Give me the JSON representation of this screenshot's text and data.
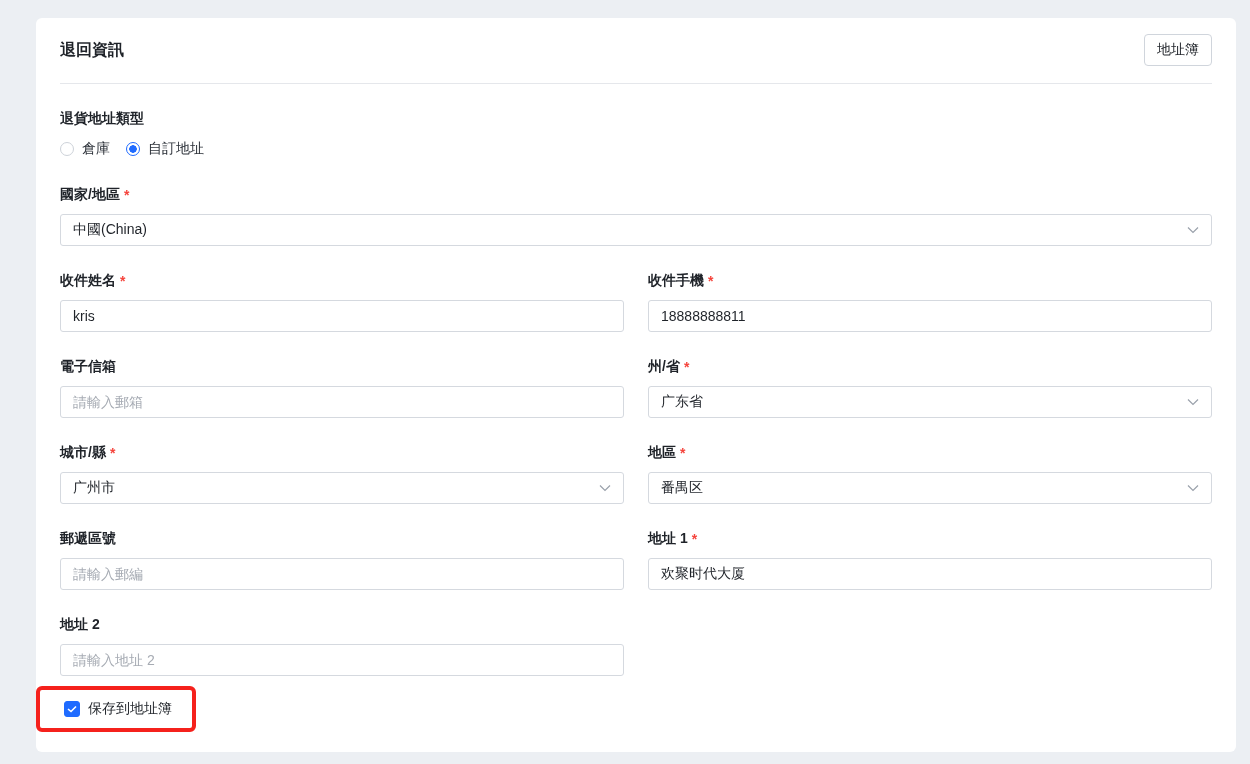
{
  "card": {
    "title": "退回資訊",
    "address_book_button": "地址簿"
  },
  "return_type": {
    "label": "退貨地址類型",
    "options": [
      {
        "label": "倉庫",
        "selected": false
      },
      {
        "label": "自訂地址",
        "selected": true
      }
    ]
  },
  "fields": [
    {
      "label": "國家/地區",
      "required_mark": "*",
      "kind": "select",
      "value": "中國(China)",
      "full_width": true
    },
    {
      "label": "收件姓名",
      "required_mark": "*",
      "kind": "input",
      "value": "kris",
      "full_width": false
    },
    {
      "label": "收件手機",
      "required_mark": "*",
      "kind": "input",
      "value": "18888888811",
      "full_width": false
    },
    {
      "label": "電子信箱",
      "kind": "input",
      "placeholder": "請輸入郵箱",
      "full_width": false
    },
    {
      "label": "州/省",
      "required_mark": "*",
      "kind": "select",
      "value": "广东省",
      "full_width": false
    },
    {
      "label": "城市/縣",
      "required_mark": "*",
      "kind": "select",
      "value": "广州市",
      "full_width": false
    },
    {
      "label": "地區",
      "required_mark": "*",
      "kind": "select",
      "value": "番禺区",
      "full_width": false
    },
    {
      "label": "郵遞區號",
      "kind": "input",
      "placeholder": "請輸入郵編",
      "full_width": false
    },
    {
      "label": "地址 1",
      "required_mark": "*",
      "kind": "input",
      "value": "欢聚时代大厦",
      "full_width": false
    },
    {
      "label": "地址 2",
      "kind": "input",
      "placeholder": "請輸入地址 2",
      "full_width": false
    }
  ],
  "save_to_address_book": {
    "label": "保存到地址簿",
    "checked": true,
    "highlighted": true
  }
}
